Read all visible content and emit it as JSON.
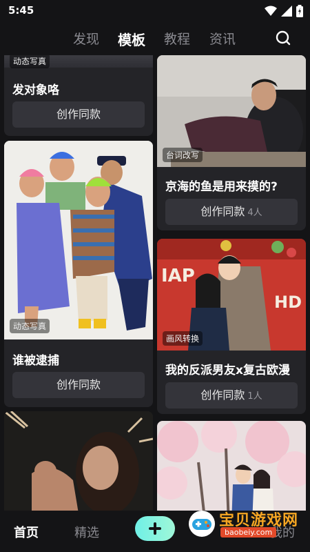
{
  "status": {
    "time": "5:45"
  },
  "nav": {
    "tabs": [
      "发现",
      "模板",
      "教程",
      "资讯"
    ],
    "active": "模板"
  },
  "cards": {
    "c1": {
      "tag": "动态写真",
      "title": "发对象咯",
      "button": "创作同款"
    },
    "c2": {
      "tag": "台词改写",
      "title": "京海的鱼是用来摸的?",
      "button": "创作同款",
      "count": "4人"
    },
    "c3": {
      "tag": "动态写真",
      "title": "谁被逮捕",
      "button": "创作同款"
    },
    "c4": {
      "tag": "画风转换",
      "title": "我的反派男友x复古欧漫",
      "button": "创作同款",
      "count": "1人"
    },
    "c5": {},
    "c6": {}
  },
  "bottom_nav": {
    "home": "首页",
    "featured": "精选",
    "mine": "我的"
  },
  "watermark": {
    "text": "宝贝游戏网",
    "url": "baobeiy.com"
  },
  "colors": {
    "background": "#141416",
    "card": "#242428",
    "button": "#34343a",
    "accent": "#6ff0e6"
  }
}
